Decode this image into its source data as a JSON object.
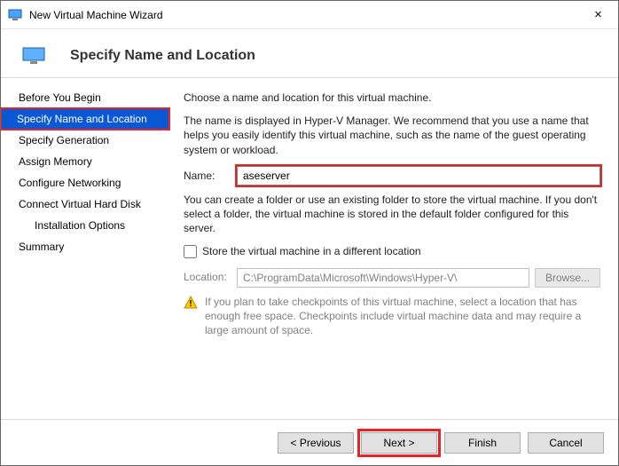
{
  "window": {
    "title": "New Virtual Machine Wizard"
  },
  "header": {
    "title": "Specify Name and Location"
  },
  "sidebar": {
    "steps": [
      {
        "label": "Before You Begin",
        "active": false,
        "indent": false
      },
      {
        "label": "Specify Name and Location",
        "active": true,
        "indent": false
      },
      {
        "label": "Specify Generation",
        "active": false,
        "indent": false
      },
      {
        "label": "Assign Memory",
        "active": false,
        "indent": false
      },
      {
        "label": "Configure Networking",
        "active": false,
        "indent": false
      },
      {
        "label": "Connect Virtual Hard Disk",
        "active": false,
        "indent": false
      },
      {
        "label": "Installation Options",
        "active": false,
        "indent": true
      },
      {
        "label": "Summary",
        "active": false,
        "indent": false
      }
    ]
  },
  "content": {
    "intro": "Choose a name and location for this virtual machine.",
    "desc": "The name is displayed in Hyper-V Manager. We recommend that you use a name that helps you easily identify this virtual machine, such as the name of the guest operating system or workload.",
    "name_label": "Name:",
    "name_value": "aseserver",
    "folder_desc": "You can create a folder or use an existing folder to store the virtual machine. If you don't select a folder, the virtual machine is stored in the default folder configured for this server.",
    "store_check_label": "Store the virtual machine in a different location",
    "location_label": "Location:",
    "location_value": "C:\\ProgramData\\Microsoft\\Windows\\Hyper-V\\",
    "browse_label": "Browse...",
    "warning": "If you plan to take checkpoints of this virtual machine, select a location that has enough free space. Checkpoints include virtual machine data and may require a large amount of space."
  },
  "footer": {
    "previous": "< Previous",
    "next": "Next >",
    "finish": "Finish",
    "cancel": "Cancel"
  }
}
